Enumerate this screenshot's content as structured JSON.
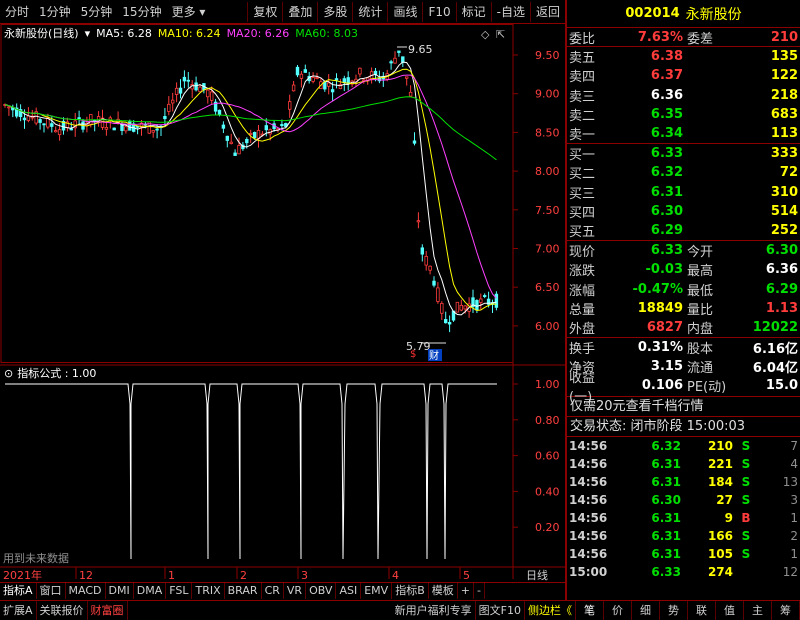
{
  "toolbar": {
    "left": [
      "分时",
      "1分钟",
      "5分钟",
      "15分钟",
      "更多"
    ],
    "right": [
      "复权",
      "叠加",
      "多股",
      "统计",
      "画线",
      "F10",
      "标记",
      "-自选",
      "返回"
    ]
  },
  "chart_info": {
    "stock": "永新股份(日线)",
    "ma5": "MA5: 6.28",
    "ma10": "MA10: 6.24",
    "ma20": "MA20: 6.26",
    "ma60": "MA60: 8.03",
    "high_label": "9.65",
    "low_label": "5.79"
  },
  "price_axis": [
    "9.50",
    "9.00",
    "8.50",
    "8.00",
    "7.50",
    "7.00",
    "6.50",
    "6.00"
  ],
  "ind_axis": [
    "1.00",
    "0.80",
    "0.60",
    "0.40",
    "0.20"
  ],
  "indicator": {
    "title": "指标公式 : 1.00",
    "note": "用到未来数据"
  },
  "time_axis": {
    "year": "2021年",
    "months": [
      "12",
      "1",
      "2",
      "3",
      "4",
      "5"
    ],
    "period": "日线"
  },
  "bottom_tabs": [
    "指标A",
    "窗口",
    "MACD",
    "DMI",
    "DMA",
    "FSL",
    "TRIX",
    "BRAR",
    "CR",
    "VR",
    "OBV",
    "ASI",
    "EMV",
    "指标B",
    "模板",
    "+",
    "-"
  ],
  "bottom_bar": {
    "left": [
      "扩展A",
      "关联报价",
      "财富圈"
    ],
    "promo": "新用户福利专享",
    "f10": "图文F10",
    "side": "侧边栏《",
    "right": [
      "笔",
      "价",
      "细",
      "势",
      "联",
      "值",
      "主",
      "筹"
    ]
  },
  "quote": {
    "code": "002014",
    "name": "永新股份",
    "weibi_label": "委比",
    "weibi": "7.63%",
    "weicha_label": "委差",
    "weicha": "210",
    "sells": [
      {
        "label": "卖五",
        "price": "6.38",
        "vol": "135"
      },
      {
        "label": "卖四",
        "price": "6.37",
        "vol": "122"
      },
      {
        "label": "卖三",
        "price": "6.36",
        "vol": "218"
      },
      {
        "label": "卖二",
        "price": "6.35",
        "vol": "683"
      },
      {
        "label": "卖一",
        "price": "6.34",
        "vol": "113"
      }
    ],
    "buys": [
      {
        "label": "买一",
        "price": "6.33",
        "vol": "333"
      },
      {
        "label": "买二",
        "price": "6.32",
        "vol": "72"
      },
      {
        "label": "买三",
        "price": "6.31",
        "vol": "310"
      },
      {
        "label": "买四",
        "price": "6.30",
        "vol": "514"
      },
      {
        "label": "买五",
        "price": "6.29",
        "vol": "252"
      }
    ],
    "stats1": [
      {
        "l1": "现价",
        "v1": "6.33",
        "l2": "今开",
        "v2": "6.30"
      },
      {
        "l1": "涨跌",
        "v1": "-0.03",
        "l2": "最高",
        "v2": "6.36"
      },
      {
        "l1": "涨幅",
        "v1": "-0.47%",
        "l2": "最低",
        "v2": "6.29"
      },
      {
        "l1": "总量",
        "v1": "18849",
        "l2": "量比",
        "v2": "1.13"
      },
      {
        "l1": "外盘",
        "v1": "6827",
        "l2": "内盘",
        "v2": "12022"
      }
    ],
    "stats2": [
      {
        "l1": "换手",
        "v1": "0.31%",
        "l2": "股本",
        "v2": "6.16亿"
      },
      {
        "l1": "净资",
        "v1": "3.15",
        "l2": "流通",
        "v2": "6.04亿"
      },
      {
        "l1": "收益(一)",
        "v1": "0.106",
        "l2": "PE(动)",
        "v2": "15.0"
      }
    ],
    "notice": "仅需20元查看千档行情",
    "status": "交易状态: 闭市阶段 15:00:03",
    "ticks": [
      {
        "t": "14:56",
        "p": "6.32",
        "v": "210",
        "bs": "S",
        "n": "7"
      },
      {
        "t": "14:56",
        "p": "6.31",
        "v": "221",
        "bs": "S",
        "n": "4"
      },
      {
        "t": "14:56",
        "p": "6.31",
        "v": "184",
        "bs": "S",
        "n": "13"
      },
      {
        "t": "14:56",
        "p": "6.30",
        "v": "27",
        "bs": "S",
        "n": "3"
      },
      {
        "t": "14:56",
        "p": "6.31",
        "v": "9",
        "bs": "B",
        "n": "1"
      },
      {
        "t": "14:56",
        "p": "6.31",
        "v": "166",
        "bs": "S",
        "n": "2"
      },
      {
        "t": "14:56",
        "p": "6.31",
        "v": "105",
        "bs": "S",
        "n": "1"
      },
      {
        "t": "15:00",
        "p": "6.33",
        "v": "274",
        "bs": "",
        "n": "12"
      }
    ]
  }
}
